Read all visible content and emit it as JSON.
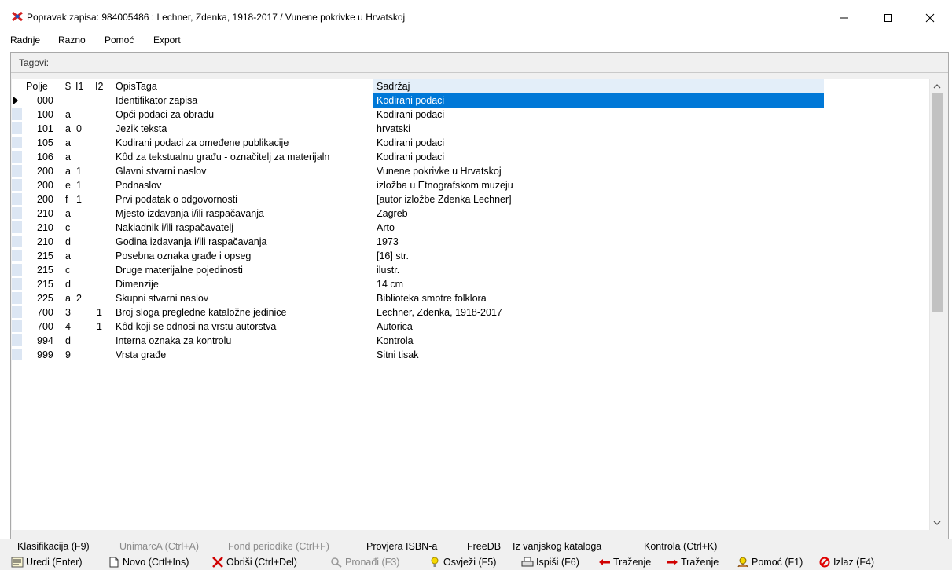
{
  "window": {
    "title": "Popravak zapisa: 984005486 : Lechner, Zdenka, 1918-2017 / Vunene pokrivke u Hrvatskoj",
    "controls": {
      "minimize": "—",
      "maximize": "☐",
      "close": "✕"
    }
  },
  "menu": [
    "Radnje",
    "Razno",
    "Pomoć",
    "Export"
  ],
  "panel_label": "Tagovi:",
  "grid": {
    "headers": {
      "polje": "Polje",
      "sub": "$",
      "i1": "I1",
      "i2": "I2",
      "opis": "OpisTaga",
      "sadrzaj": "Sadržaj"
    },
    "rows": [
      {
        "polje": "000",
        "sub": "",
        "i1": "",
        "i2": "",
        "opis": "Identifikator zapisa",
        "sadrzaj": "Kodirani podaci"
      },
      {
        "polje": "100",
        "sub": "a",
        "i1": "",
        "i2": "",
        "opis": "Opći podaci za obradu",
        "sadrzaj": "Kodirani podaci"
      },
      {
        "polje": "101",
        "sub": "a",
        "i1": "0",
        "i2": "",
        "opis": "Jezik teksta",
        "sadrzaj": "hrvatski"
      },
      {
        "polje": "105",
        "sub": "a",
        "i1": "",
        "i2": "",
        "opis": "Kodirani podaci za omeđene publikacije",
        "sadrzaj": "Kodirani podaci"
      },
      {
        "polje": "106",
        "sub": "a",
        "i1": "",
        "i2": "",
        "opis": "Kôd za tekstualnu građu - označitelj za materijaln",
        "sadrzaj": "Kodirani podaci"
      },
      {
        "polje": "200",
        "sub": "a",
        "i1": "1",
        "i2": "",
        "opis": "Glavni stvarni naslov",
        "sadrzaj": "Vunene pokrivke u Hrvatskoj"
      },
      {
        "polje": "200",
        "sub": "e",
        "i1": "1",
        "i2": "",
        "opis": "Podnaslov",
        "sadrzaj": "izložba u Etnografskom muzeju"
      },
      {
        "polje": "200",
        "sub": "f",
        "i1": "1",
        "i2": "",
        "opis": "Prvi podatak o odgovornosti",
        "sadrzaj": "[autor izložbe Zdenka Lechner]"
      },
      {
        "polje": "210",
        "sub": "a",
        "i1": "",
        "i2": "",
        "opis": "Mjesto izdavanja i/ili raspačavanja",
        "sadrzaj": "Zagreb"
      },
      {
        "polje": "210",
        "sub": "c",
        "i1": "",
        "i2": "",
        "opis": "Nakladnik i/ili raspačavatelj",
        "sadrzaj": "Arto"
      },
      {
        "polje": "210",
        "sub": "d",
        "i1": "",
        "i2": "",
        "opis": "Godina izdavanja i/ili raspačavanja",
        "sadrzaj": "1973"
      },
      {
        "polje": "215",
        "sub": "a",
        "i1": "",
        "i2": "",
        "opis": "Posebna oznaka građe i opseg",
        "sadrzaj": "[16] str."
      },
      {
        "polje": "215",
        "sub": "c",
        "i1": "",
        "i2": "",
        "opis": "Druge materijalne pojedinosti",
        "sadrzaj": "ilustr."
      },
      {
        "polje": "215",
        "sub": "d",
        "i1": "",
        "i2": "",
        "opis": "Dimenzije",
        "sadrzaj": "14 cm"
      },
      {
        "polje": "225",
        "sub": "a",
        "i1": "2",
        "i2": "",
        "opis": "Skupni stvarni naslov",
        "sadrzaj": "Biblioteka smotre folklora"
      },
      {
        "polje": "700",
        "sub": "3",
        "i1": "",
        "i2": "1",
        "opis": "Broj sloga pregledne kataložne jedinice",
        "sadrzaj": "Lechner, Zdenka, 1918-2017"
      },
      {
        "polje": "700",
        "sub": "4",
        "i1": "",
        "i2": "1",
        "opis": "Kôd koji se odnosi na vrstu autorstva",
        "sadrzaj": "Autorica"
      },
      {
        "polje": "994",
        "sub": "d",
        "i1": "",
        "i2": "",
        "opis": "Interna oznaka za kontrolu",
        "sadrzaj": "Kontrola"
      },
      {
        "polje": "999",
        "sub": "9",
        "i1": "",
        "i2": "",
        "opis": "Vrsta građe",
        "sadrzaj": "Sitni tisak"
      }
    ]
  },
  "toolbar1": [
    {
      "label": "Klasifikacija (F9)",
      "enabled": true
    },
    {
      "label": "UnimarcA (Ctrl+A)",
      "enabled": false
    },
    {
      "label": "Fond periodike (Ctrl+F)",
      "enabled": false
    },
    {
      "label": "Provjera ISBN-a",
      "enabled": true
    },
    {
      "label": "FreeDB",
      "enabled": true
    },
    {
      "label": "Iz vanjskog kataloga",
      "enabled": true
    },
    {
      "label": "Kontrola (Ctrl+K)",
      "enabled": true
    }
  ],
  "toolbar2": [
    {
      "label": "Uredi (Enter)",
      "icon": "edit-icon",
      "enabled": true
    },
    {
      "label": "Novo (Crtl+Ins)",
      "icon": "new-document-icon",
      "enabled": true
    },
    {
      "label": "Obriši (Ctrl+Del)",
      "icon": "delete-icon",
      "enabled": true
    },
    {
      "label": "Pronađi (F3)",
      "icon": "find-icon",
      "enabled": false
    },
    {
      "label": "Osvježi (F5)",
      "icon": "refresh-icon",
      "enabled": true
    },
    {
      "label": "Ispiši (F6)",
      "icon": "print-icon",
      "enabled": true
    },
    {
      "label": "Traženje",
      "icon": "arrow-left-icon",
      "enabled": true
    },
    {
      "label": "Traženje",
      "icon": "arrow-right-icon",
      "enabled": true
    },
    {
      "label": "Pomoć (F1)",
      "icon": "help-icon",
      "enabled": true
    },
    {
      "label": "Izlaz (F4)",
      "icon": "exit-icon",
      "enabled": true
    }
  ],
  "colors": {
    "selection": "#0078d7",
    "header_fill": "#e3eef9",
    "row_selector": "#dce6f3",
    "delete": "#d00000",
    "exit": "#e00000"
  }
}
